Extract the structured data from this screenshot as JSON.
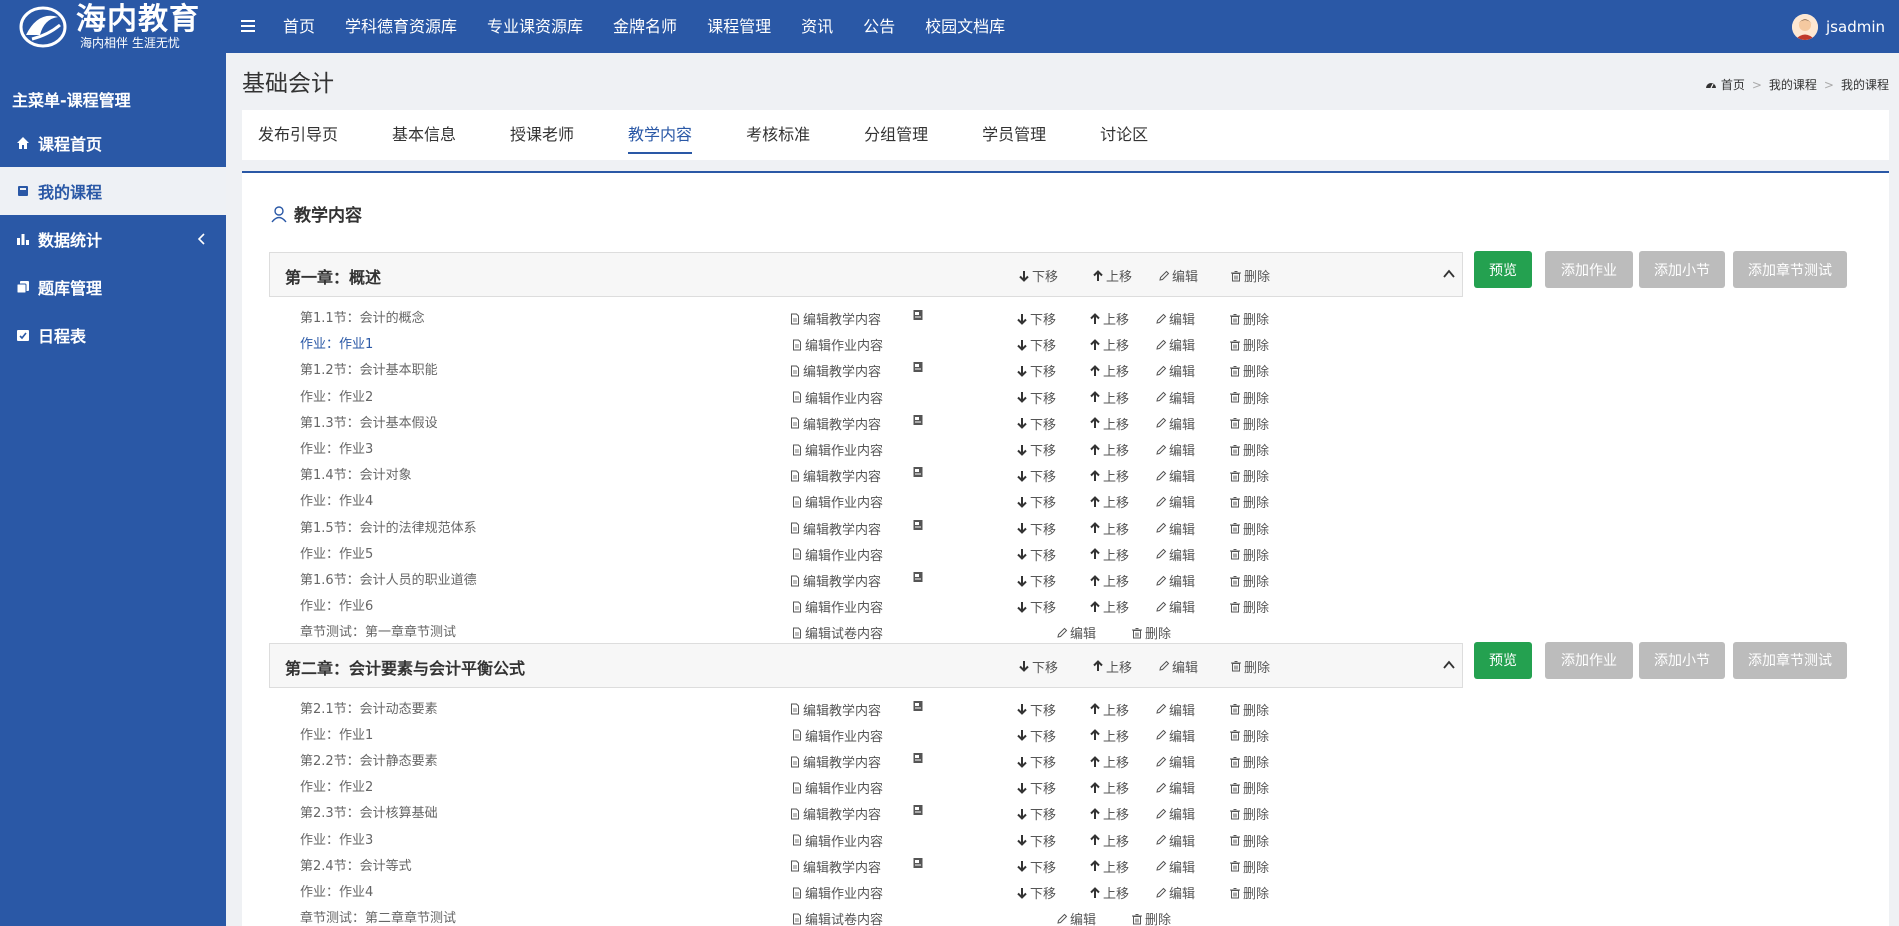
{
  "brand": {
    "name": "海内教育",
    "slogan": "海内相伴 生涯无忧"
  },
  "nav": {
    "items": [
      "首页",
      "学科德育资源库",
      "专业课资源库",
      "金牌名师",
      "课程管理",
      "资讯",
      "公告",
      "校园文档库"
    ]
  },
  "user": {
    "name": "jsadmin"
  },
  "sidebar": {
    "title": "主菜单-课程管理",
    "items": [
      "课程首页",
      "我的课程",
      "数据统计",
      "题库管理",
      "日程表"
    ]
  },
  "page": {
    "title": "基础会计"
  },
  "breadcrumb": [
    "首页",
    "我的课程",
    "我的课程"
  ],
  "tabs": [
    "发布引导页",
    "基本信息",
    "授课老师",
    "教学内容",
    "考核标准",
    "分组管理",
    "学员管理",
    "讨论区"
  ],
  "section": {
    "title": "教学内容"
  },
  "labels": {
    "down": "下移",
    "up": "上移",
    "edit": "编辑",
    "delete": "删除",
    "edit_content": "编辑教学内容",
    "edit_homework": "编辑作业内容",
    "edit_exam": "编辑试卷内容"
  },
  "buttons": {
    "preview": "预览",
    "add_homework": "添加作业",
    "add_section": "添加小节",
    "add_test": "添加章节测试"
  },
  "chapters": [
    {
      "title": "第一章：概述",
      "rows": [
        {
          "text": "第1.1节：会计的概念",
          "kind": "section"
        },
        {
          "text": "作业：作业1",
          "kind": "homework"
        },
        {
          "text": "第1.2节：会计基本职能",
          "kind": "section"
        },
        {
          "text": "作业：作业2",
          "kind": "homework"
        },
        {
          "text": "第1.3节：会计基本假设",
          "kind": "section"
        },
        {
          "text": "作业：作业3",
          "kind": "homework"
        },
        {
          "text": "第1.4节：会计对象",
          "kind": "section"
        },
        {
          "text": "作业：作业4",
          "kind": "homework"
        },
        {
          "text": "第1.5节：会计的法律规范体系",
          "kind": "section"
        },
        {
          "text": "作业：作业5",
          "kind": "homework"
        },
        {
          "text": "第1.6节：会计人员的职业道德",
          "kind": "section"
        },
        {
          "text": "作业：作业6",
          "kind": "homework"
        },
        {
          "text": "章节测试：第一章章节测试",
          "kind": "test"
        }
      ]
    },
    {
      "title": "第二章：会计要素与会计平衡公式",
      "rows": [
        {
          "text": "第2.1节：会计动态要素",
          "kind": "section"
        },
        {
          "text": "作业：作业1",
          "kind": "homework"
        },
        {
          "text": "第2.2节：会计静态要素",
          "kind": "section"
        },
        {
          "text": "作业：作业2",
          "kind": "homework"
        },
        {
          "text": "第2.3节：会计核算基础",
          "kind": "section"
        },
        {
          "text": "作业：作业3",
          "kind": "homework"
        },
        {
          "text": "第2.4节：会计等式",
          "kind": "section"
        },
        {
          "text": "作业：作业4",
          "kind": "homework"
        },
        {
          "text": "章节测试：第二章章节测试",
          "kind": "test"
        }
      ]
    }
  ]
}
